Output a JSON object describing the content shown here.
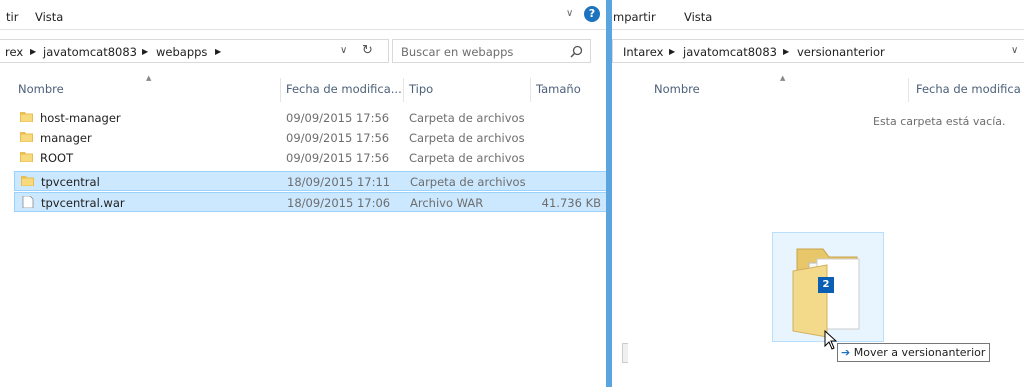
{
  "left_window": {
    "ribbon": {
      "tab_share_partial": "tir",
      "tab_view": "Vista"
    },
    "address": {
      "crumbs": [
        "rex",
        "javatomcat8083",
        "webapps"
      ],
      "search_placeholder": "Buscar en webapps"
    },
    "columns": {
      "name": "Nombre",
      "date": "Fecha de modifica...",
      "type": "Tipo",
      "size": "Tamaño"
    },
    "rows": [
      {
        "name": "host-manager",
        "date": "09/09/2015 17:56",
        "type": "Carpeta de archivos",
        "size": "",
        "icon": "folder-icon",
        "selected": false
      },
      {
        "name": "manager",
        "date": "09/09/2015 17:56",
        "type": "Carpeta de archivos",
        "size": "",
        "icon": "folder-icon",
        "selected": false
      },
      {
        "name": "ROOT",
        "date": "09/09/2015 17:56",
        "type": "Carpeta de archivos",
        "size": "",
        "icon": "folder-icon",
        "selected": false
      },
      {
        "name": "tpvcentral",
        "date": "18/09/2015 17:11",
        "type": "Carpeta de archivos",
        "size": "",
        "icon": "folder-icon",
        "selected": true
      },
      {
        "name": "tpvcentral.war",
        "date": "18/09/2015 17:06",
        "type": "Archivo WAR",
        "size": "41.736 KB",
        "icon": "file-icon",
        "selected": true
      }
    ]
  },
  "right_window": {
    "ribbon": {
      "tab_share_partial": "mpartir",
      "tab_view": "Vista"
    },
    "address": {
      "crumbs": [
        "Intarex",
        "javatomcat8083",
        "versionanterior"
      ]
    },
    "columns": {
      "name": "Nombre",
      "date": "Fecha de modifica"
    },
    "empty_message": "Esta carpeta está vacía."
  },
  "drag": {
    "count": "2",
    "tooltip": "Mover a versionanterior"
  },
  "colors": {
    "accent": "#5aa5de",
    "selection": "#cce8ff",
    "selection_border": "#99d1ff",
    "help": "#1e73be"
  }
}
